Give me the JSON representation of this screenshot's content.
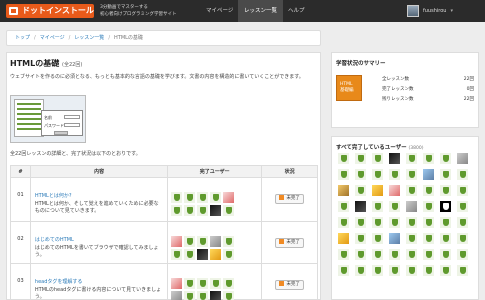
{
  "header": {
    "logo_text": "ドットインストール",
    "tagline_1": "3分動画でマスターする",
    "tagline_2": "初心者向けプログラミング学習サイト",
    "nav": [
      "マイページ",
      "レッスン一覧",
      "ヘルプ"
    ],
    "active_nav": 1,
    "user_name": "fuushirou"
  },
  "breadcrumb": {
    "items": [
      "トップ",
      "マイページ",
      "レッスン一覧"
    ],
    "current": "HTMLの基礎"
  },
  "lesson": {
    "title": "HTMLの基礎",
    "count_label": "(全22回)",
    "intro": "ウェブサイトを作るのに必須となる、もっとも基本的な言語の基礎を学びます。文書の内容を構造的に書いていくことができます。",
    "sample_labels": [
      "名前",
      "パスワード"
    ],
    "summary": "全22回レッスンの詳細と、完了状況は以下のとおりです。"
  },
  "table": {
    "headers": [
      "#",
      "内容",
      "完了ユーザー",
      "状況"
    ],
    "rows": [
      {
        "num": "01",
        "title": "HTMLとは何か?",
        "desc": "HTMLとは何か、そして覚えを進めていくために必要なものについて見ていきます。",
        "status": "未完了",
        "badges": [
          "shield",
          "shield",
          "shield",
          "shield",
          "photo-red",
          "shield",
          "shield",
          "shield",
          "photo-dark",
          "shield"
        ]
      },
      {
        "num": "02",
        "title": "はじめてのHTML",
        "desc": "はじめてのHTMLを書いてブラウザで確認してみましょう。",
        "status": "未完了",
        "badges": [
          "photo-red",
          "shield",
          "shield",
          "photo-gray",
          "shield",
          "shield",
          "shield",
          "photo-dark",
          "photo-yellow",
          "shield"
        ]
      },
      {
        "num": "03",
        "title": "headタグを理解する",
        "desc": "HTMLのheadタグに書ける内容について見ていきましょう。",
        "status": "未完了",
        "badges": [
          "photo-red",
          "shield",
          "shield",
          "shield",
          "shield",
          "photo-gray",
          "shield",
          "shield",
          "photo-dark",
          "shield"
        ]
      }
    ]
  },
  "sidebar": {
    "summary_title": "学習状況のサマリー",
    "icon_text_1": "HTML",
    "icon_text_2": "基礎編",
    "stats": [
      {
        "label": "全レッスン数",
        "value": "22回"
      },
      {
        "label": "完了レッスン数",
        "value": "0回"
      },
      {
        "label": "残りレッスン数",
        "value": "22回"
      }
    ],
    "all_done_title": "すべて完了しているユーザー",
    "all_done_count": "(3800)",
    "all_done_badges": [
      "shield",
      "shield",
      "shield",
      "photo-dark",
      "shield",
      "shield",
      "shield",
      "photo-gray",
      "shield",
      "shield",
      "shield",
      "shield",
      "shield",
      "photo-sky",
      "shield",
      "shield",
      "photo-gold",
      "shield",
      "photo-yellow",
      "photo-red",
      "shield",
      "shield",
      "shield",
      "shield",
      "shield",
      "photo-dark",
      "shield",
      "shield",
      "photo-gray",
      "shield",
      "inv",
      "shield",
      "shield",
      "shield",
      "shield",
      "shield",
      "shield",
      "shield",
      "shield",
      "shield",
      "photo-yellow",
      "shield",
      "shield",
      "photo-sky",
      "shield",
      "shield",
      "shield",
      "shield",
      "shield",
      "shield",
      "shield",
      "shield",
      "shield",
      "shield",
      "shield",
      "shield",
      "shield",
      "shield",
      "shield",
      "shield",
      "shield",
      "shield",
      "shield",
      "shield"
    ]
  }
}
